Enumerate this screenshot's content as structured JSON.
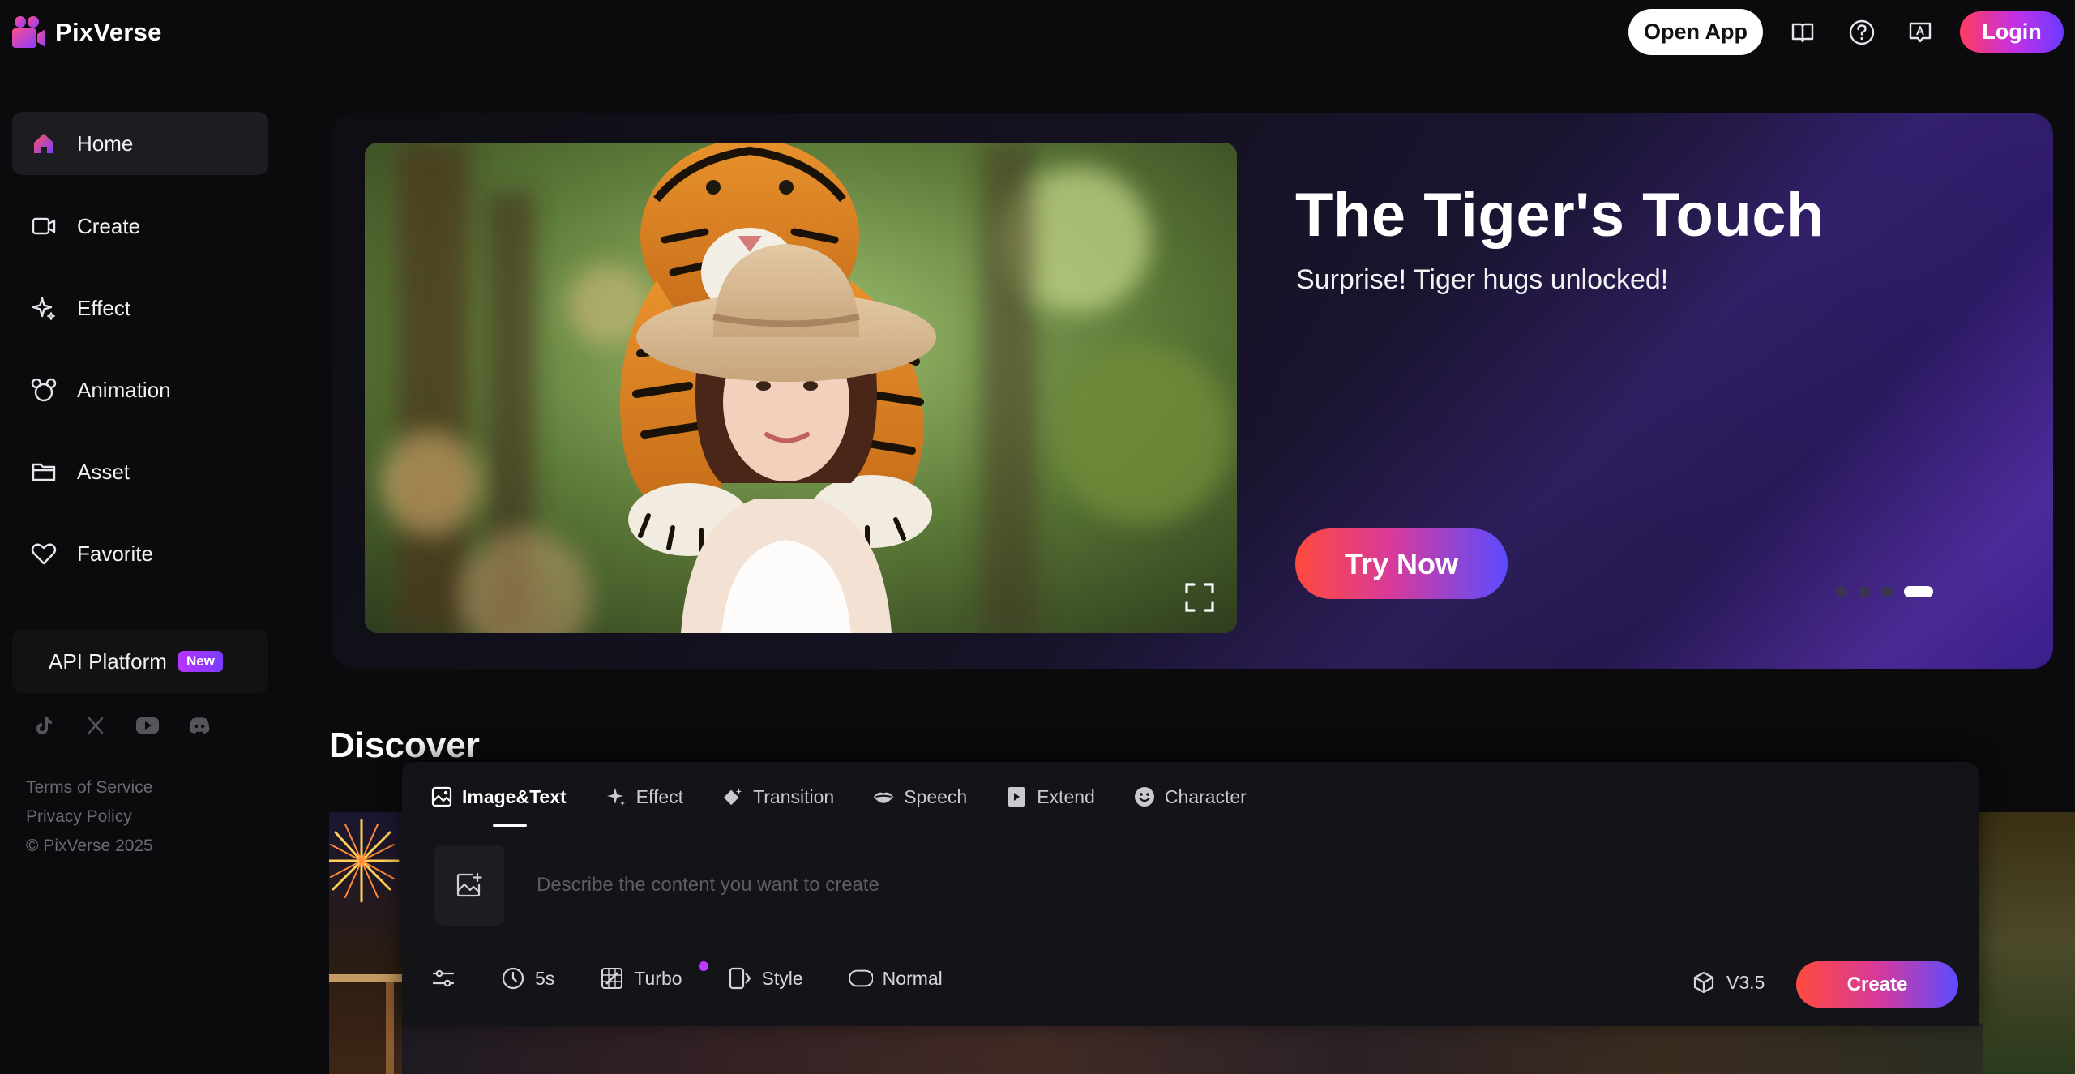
{
  "app": {
    "name": "PixVerse",
    "accent_gradient": [
      "#ff4a3c",
      "#d83a9a",
      "#5b4cff"
    ]
  },
  "header": {
    "open_app_label": "Open App",
    "login_label": "Login",
    "icons": [
      "book-icon",
      "help-icon",
      "feedback-icon"
    ]
  },
  "sidebar": {
    "items": [
      {
        "label": "Home",
        "icon": "home-icon",
        "active": true
      },
      {
        "label": "Create",
        "icon": "video-camera-icon"
      },
      {
        "label": "Effect",
        "icon": "sparkle-icon"
      },
      {
        "label": "Animation",
        "icon": "mouse-head-icon"
      },
      {
        "label": "Asset",
        "icon": "folder-icon"
      },
      {
        "label": "Favorite",
        "icon": "heart-icon"
      }
    ],
    "api_platform": {
      "label": "API Platform",
      "badge": "New"
    },
    "social": [
      "tiktok-icon",
      "x-icon",
      "youtube-icon",
      "discord-icon"
    ],
    "footer": {
      "terms": "Terms of Service",
      "privacy": "Privacy Policy",
      "copyright": "© PixVerse 2025"
    }
  },
  "banner": {
    "title": "The Tiger's Touch",
    "subtitle": "Surprise! Tiger hugs unlocked!",
    "cta_label": "Try Now",
    "slide_count": 4,
    "active_slide": 4
  },
  "discover": {
    "title": "Discover"
  },
  "composer": {
    "tabs": [
      {
        "label": "Image&Text",
        "icon": "image-icon",
        "active": true
      },
      {
        "label": "Effect",
        "icon": "sparkle-icon"
      },
      {
        "label": "Transition",
        "icon": "transition-icon"
      },
      {
        "label": "Speech",
        "icon": "lips-icon"
      },
      {
        "label": "Extend",
        "icon": "extend-icon"
      },
      {
        "label": "Character",
        "icon": "smile-icon"
      }
    ],
    "prompt_placeholder": "Describe the content you want to create",
    "options": {
      "duration": "5s",
      "speed": "Turbo",
      "style": "Style",
      "quality": "Normal"
    },
    "model_version": "V3.5",
    "create_label": "Create"
  }
}
